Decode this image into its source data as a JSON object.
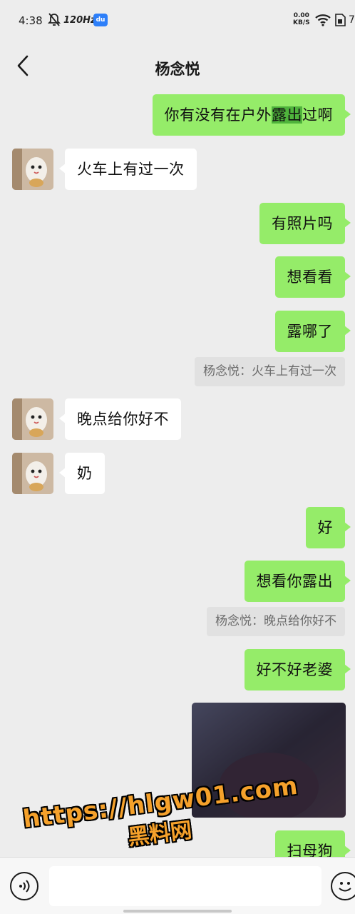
{
  "status_bar": {
    "time": "4:38",
    "refresh_rate": "120Hz",
    "net_speed_value": "0.00",
    "net_speed_unit": "KB/S",
    "battery_partial": "7"
  },
  "title_bar": {
    "title": "杨念悦"
  },
  "messages": [
    {
      "side": "out",
      "parts": [
        "你有没有在户外",
        "露出",
        "过啊"
      ]
    },
    {
      "side": "in",
      "text": "火车上有过一次"
    },
    {
      "side": "out",
      "text": "有照片吗"
    },
    {
      "side": "out",
      "text": "想看看"
    },
    {
      "side": "out",
      "text": "露哪了"
    },
    {
      "side": "quote",
      "text": "杨念悦：火车上有过一次"
    },
    {
      "side": "in",
      "text": "晚点给你好不"
    },
    {
      "side": "in",
      "text": "奶"
    },
    {
      "side": "out",
      "text": "好"
    },
    {
      "side": "out",
      "text": "想看你露出"
    },
    {
      "side": "quote",
      "text": "杨念悦：晚点给你好不"
    },
    {
      "side": "out",
      "text": "好不好老婆"
    },
    {
      "side": "out",
      "text": "扫母狗"
    }
  ],
  "watermark": {
    "line1": "https://hlgw01.com",
    "line2": "黑料网"
  },
  "input_bar": {
    "value": ""
  },
  "colors": {
    "outgoing_bubble": "#95ec69",
    "incoming_bubble": "#ffffff",
    "background": "#ededed",
    "watermark": "#f5a12b"
  }
}
